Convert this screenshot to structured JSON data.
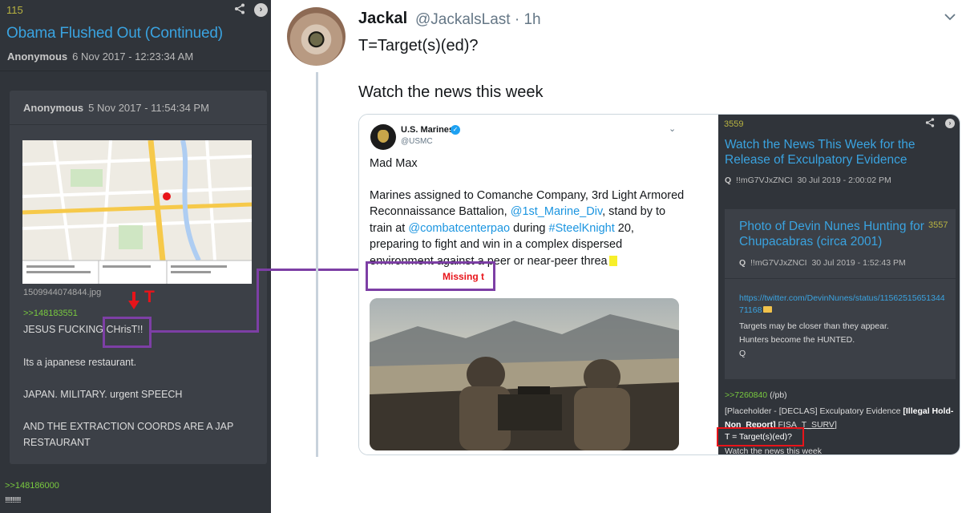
{
  "board": {
    "post_number": "115",
    "title": "Obama Flushed Out (Continued)",
    "author": "Anonymous",
    "date": "6 Nov 2017 - 12:23:34 AM",
    "quoted_post": {
      "author": "Anonymous",
      "date": "5 Nov 2017 - 11:54:34 PM",
      "filename": "1509944074844.jpg",
      "reply_link": ">>148183551",
      "lines": [
        "JESUS FUCKING CHrisT!!",
        "Its a japanese restaurant.",
        "JAPAN. MILITARY. urgent SPEECH",
        "AND THE EXTRACTION COORDS ARE A JAP",
        "RESTAURANT"
      ]
    },
    "annotation_T": "T",
    "bottom_reply_link": ">>148186000",
    "bottom_text": "!!!!!!!!!!!"
  },
  "tweet": {
    "display_name": "Jackal",
    "handle_time": "@JackalsLast · 1h",
    "line1": "T=Target(s)(ed)?",
    "line2": "Watch the news this week"
  },
  "marines_tweet": {
    "name": "U.S. Marines",
    "handle": "@USMC",
    "line1": "Mad Max",
    "body_before": "Marines assigned to Comanche Company, 3rd Light Armored Reconnaissance Battalion, ",
    "mention1": "@1st_Marine_Div",
    "body_mid1": ", stand by to train at ",
    "mention2": "@combatcenterpao",
    "body_mid2": " during ",
    "hashtag": "#SteelKnight",
    "body_after": " 20, preparing to fight and win in a complex dispersed environment against a peer or near-peer threa",
    "missing_label": "Missing t"
  },
  "q_post": {
    "number": "3559",
    "title": "Watch the News This Week for the Release of Exculpatory Evidence",
    "meta_q": "Q",
    "meta_trip": "!!mG7VJxZNCI",
    "meta_date": "30 Jul 2019 - 2:00:02 PM",
    "inner": {
      "title": "Photo of Devin Nunes Hunting for Chupacabras (circa 2001)",
      "number": "3557",
      "meta_q": "Q",
      "meta_trip": "!!mG7VJxZNCI",
      "meta_date": "30 Jul 2019 - 1:52:43 PM",
      "url": "https://twitter.com/DevinNunes/status/1156251565134471168",
      "text1": "Targets may be closer than they appear.",
      "text2": "Hunters become the HUNTED.",
      "text3": "Q"
    },
    "reply_link": ">>7260840",
    "reply_suffix": " (/pb)",
    "placeholder_a": "[Placeholder - [DECLAS] Exculpatory Evidence ",
    "placeholder_b": "[Illegal Hold-Non_Report]",
    "placeholder_c": " FISA_T_SURV",
    "placeholder_d": "]",
    "t_line": "T = Target(s)(ed)?",
    "watch_line": "Watch the news this week"
  },
  "colors": {
    "board_bg": "#30343a",
    "board_link": "#3aa3e0",
    "greentext": "#79c93f",
    "annotation_purple": "#7d3fa5",
    "annotation_red": "#e8141a",
    "twitter_blue": "#1b95e0"
  },
  "icons": [
    "share-icon",
    "navigate-icon",
    "chevron-down-icon",
    "verified-icon"
  ]
}
